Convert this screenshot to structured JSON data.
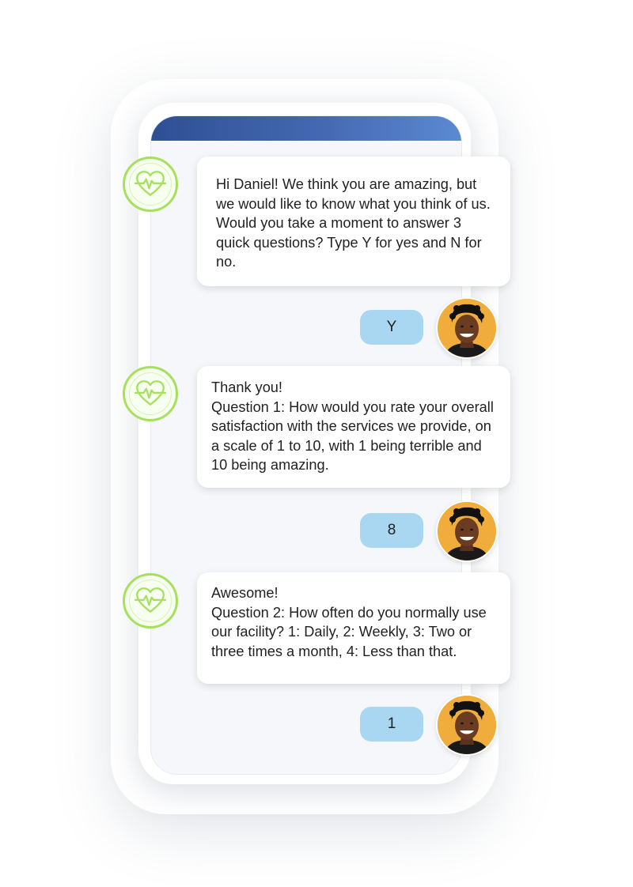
{
  "conversation": {
    "messages": [
      {
        "text": "Hi Daniel! We think you are amazing, but we would like to know what you think of us. Would you take a moment to answer 3 quick questions? Type Y for yes and N for no."
      },
      {
        "text": "Thank you!\nQuestion 1: How would you rate your overall satisfaction with the services we provide, on a scale of 1 to 10, with 1 being terrible and 10 being amazing."
      },
      {
        "text": "Awesome!\nQuestion 2: How often do you normally use our facility? 1: Daily, 2: Weekly, 3: Two or three times a month, 4: Less than that."
      }
    ],
    "replies": [
      {
        "text": "Y"
      },
      {
        "text": "8"
      },
      {
        "text": "1"
      }
    ]
  },
  "icons": {
    "bot": "heart-pulse-icon",
    "user": "user-photo"
  },
  "colors": {
    "header_start": "#2f4f93",
    "header_end": "#5b8ad2",
    "bot_ring": "#a7e05d",
    "reply_bubble": "#a9d6f0",
    "user_avatar_bg": "#f0ad3c"
  }
}
